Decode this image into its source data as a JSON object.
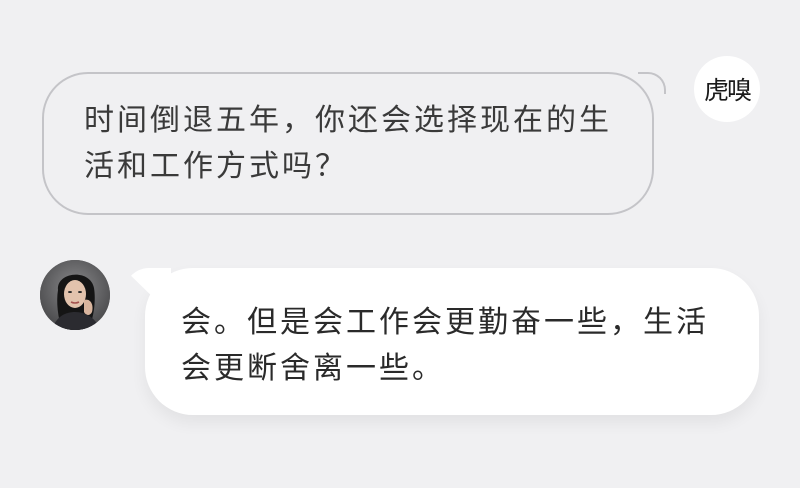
{
  "brand": {
    "logo_text": "虎嗅",
    "accent_color": "#d23a2a"
  },
  "messages": [
    {
      "sender": "interviewer",
      "text": "时间倒退五年，你还会选择现在的生活和工作方式吗？"
    },
    {
      "sender": "interviewee",
      "text": "会。但是会工作会更勤奋一些，生活会更断舍离一些。"
    }
  ],
  "colors": {
    "background": "#f0f0f2",
    "question_border": "#c4c4c8",
    "answer_bubble": "#ffffff"
  }
}
